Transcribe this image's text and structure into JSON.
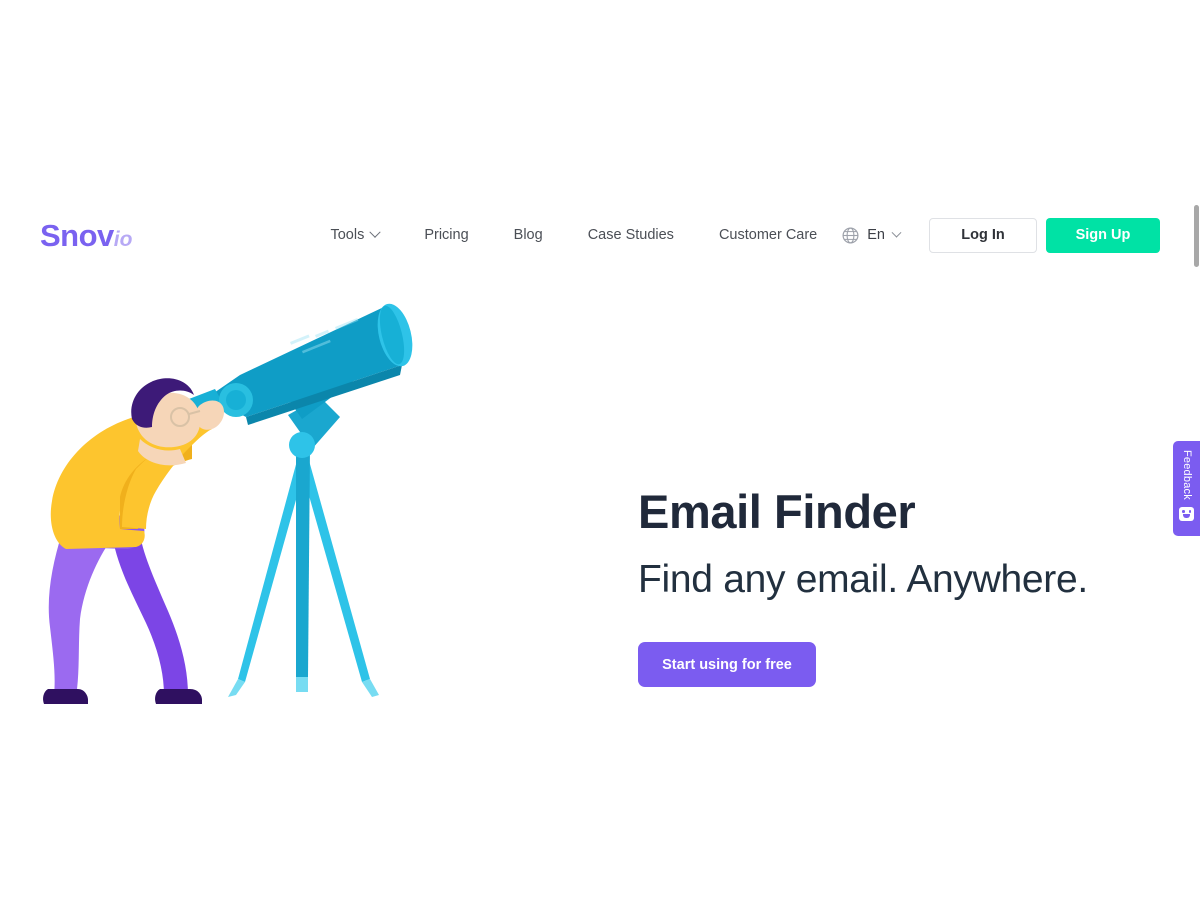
{
  "brand": {
    "logo_main": "Snov",
    "logo_suffix": "io",
    "logo_color": "#7a62f0",
    "logo_suffix_color": "#b7a9f5"
  },
  "nav": {
    "items": [
      {
        "label": "Tools",
        "has_dropdown": true,
        "icon": "chevron-down-icon"
      },
      {
        "label": "Pricing",
        "has_dropdown": false
      },
      {
        "label": "Blog",
        "has_dropdown": false
      },
      {
        "label": "Case Studies",
        "has_dropdown": false
      },
      {
        "label": "Customer Care",
        "has_dropdown": false
      }
    ]
  },
  "header_actions": {
    "language": {
      "icon": "globe-icon",
      "value": "En",
      "dropdown_icon": "chevron-down-icon"
    },
    "login_label": "Log In",
    "signup_label": "Sign Up",
    "signup_color": "#00e2a5"
  },
  "hero": {
    "title": "Email Finder",
    "subtitle": "Find any email. Anywhere.",
    "cta_label": "Start using for free",
    "cta_color": "#7b5cf0",
    "illustration": {
      "name": "man-with-telescope-illustration",
      "telescope_color": "#0c9fc8",
      "telescope_light_color": "#29bfe0",
      "shirt_color": "#fdc52e",
      "pants_color": "#7c45e6",
      "hair_color": "#3d1a78",
      "skin_color": "#f6d6b8"
    }
  },
  "feedback": {
    "label": "Feedback",
    "icon": "smiley-face-icon",
    "color": "#7b5cf0"
  },
  "scrollbar": {
    "name": "vertical-scrollbar",
    "thumb_color": "#a8a8a8"
  }
}
